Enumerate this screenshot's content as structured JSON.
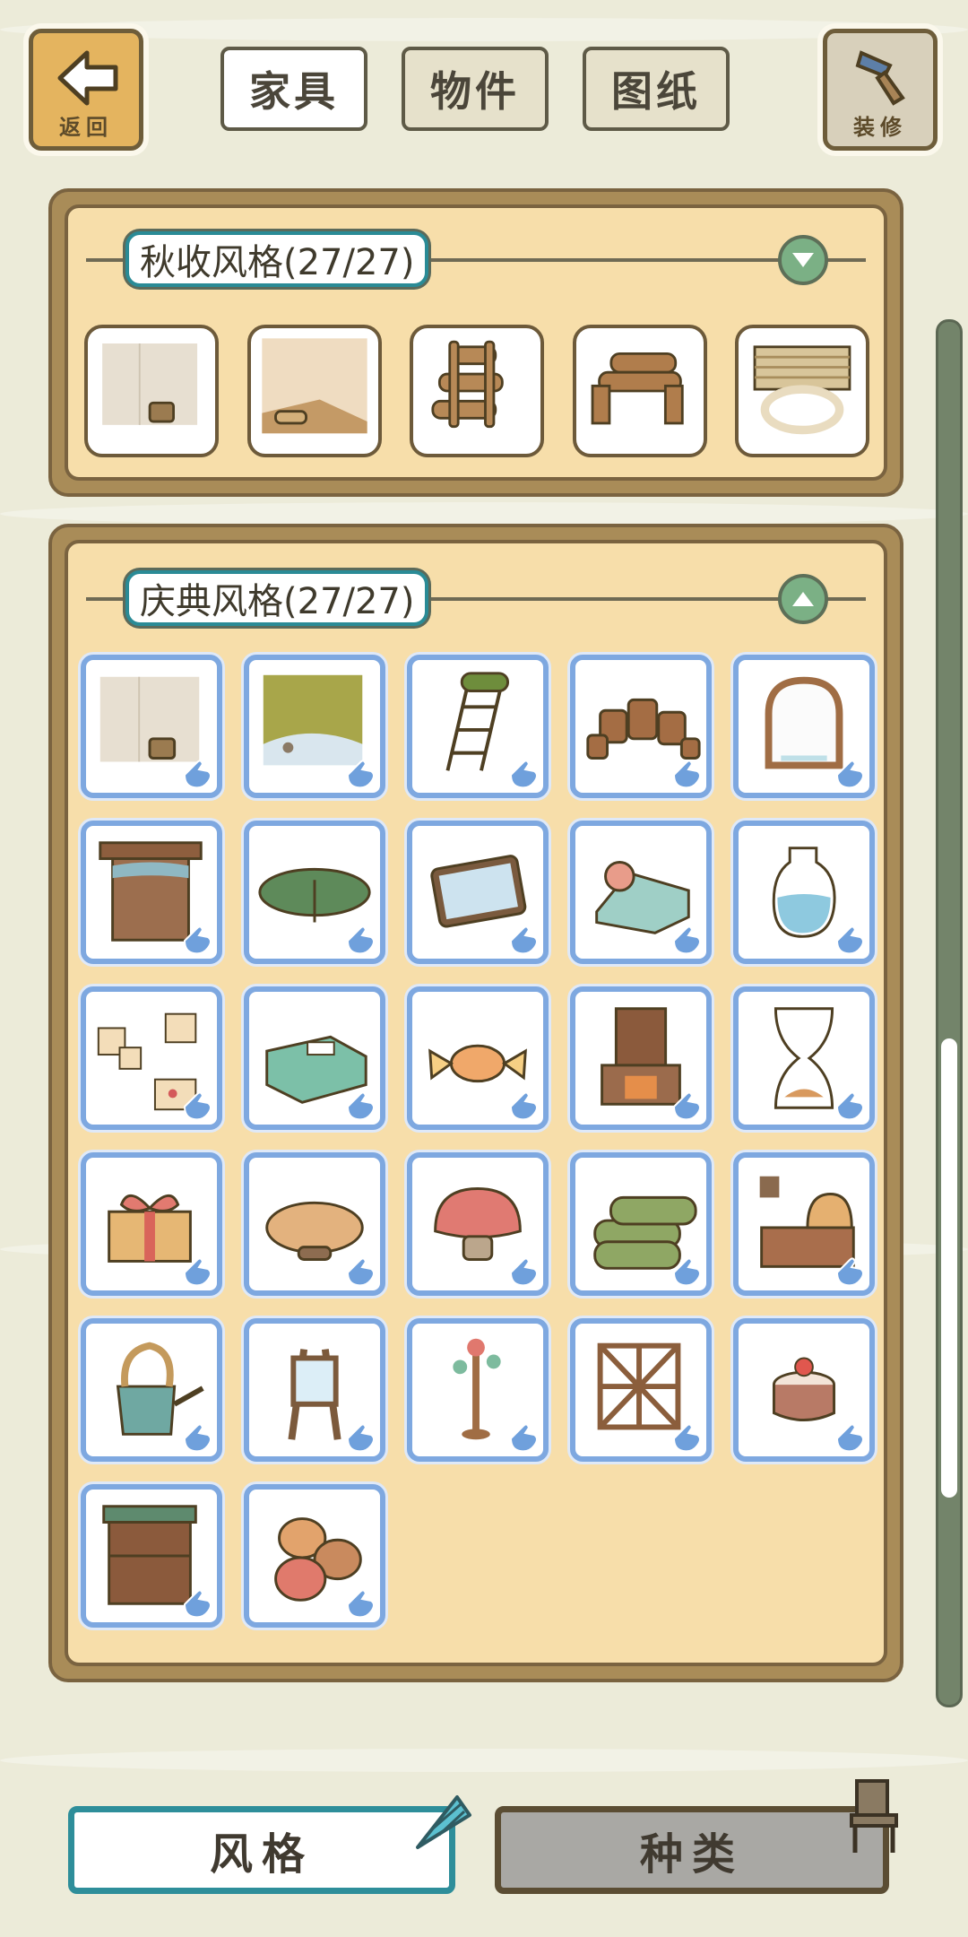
{
  "top_bar": {
    "back_label": "返回",
    "decorate_label": "装修",
    "tabs": [
      {
        "label": "家具",
        "active": true
      },
      {
        "label": "物件",
        "active": false
      },
      {
        "label": "图纸",
        "active": false
      }
    ]
  },
  "sections": [
    {
      "title": "秋收风格(27/27)",
      "expanded": false,
      "toggle_icon": "chevron-down-icon",
      "items": [
        "wall-with-bucket-icon",
        "floor-with-basket-icon",
        "log-ladder-icon",
        "log-bench-icon",
        "bamboo-blind-icon"
      ]
    },
    {
      "title": "庆典风格(27/27)",
      "expanded": true,
      "toggle_icon": "chevron-up-icon",
      "items": [
        "wall-with-bucket-icon",
        "grass-floor-icon",
        "ladder-icon",
        "wood-stumps-icon",
        "arched-window-icon",
        "wooden-door-icon",
        "green-cushion-icon",
        "tablet-icon",
        "bed-icon",
        "glass-vase-icon",
        "memo-notes-icon",
        "tackle-box-icon",
        "candy-icon",
        "fireplace-cabinet-icon",
        "hourglass-icon",
        "gift-box-icon",
        "mushroom-table-icon",
        "red-mushroom-stool-icon",
        "rolled-mats-icon",
        "stove-icon",
        "watering-can-icon",
        "easel-mirror-icon",
        "coat-rack-icon",
        "wood-fence-icon",
        "cake-icon",
        "wooden-cabinet-icon",
        "flower-sacks-icon"
      ]
    }
  ],
  "bottom_tabs": [
    {
      "label": "风格",
      "active": true
    },
    {
      "label": "种类",
      "active": false
    }
  ],
  "colors": {
    "background": "#ecebd9",
    "panel_fill": "#f7deaa",
    "panel_border": "#7a6340",
    "slot_border_blue": "#7ea8e0",
    "title_border": "#2a8b96",
    "toggle_green": "#7bb085"
  }
}
